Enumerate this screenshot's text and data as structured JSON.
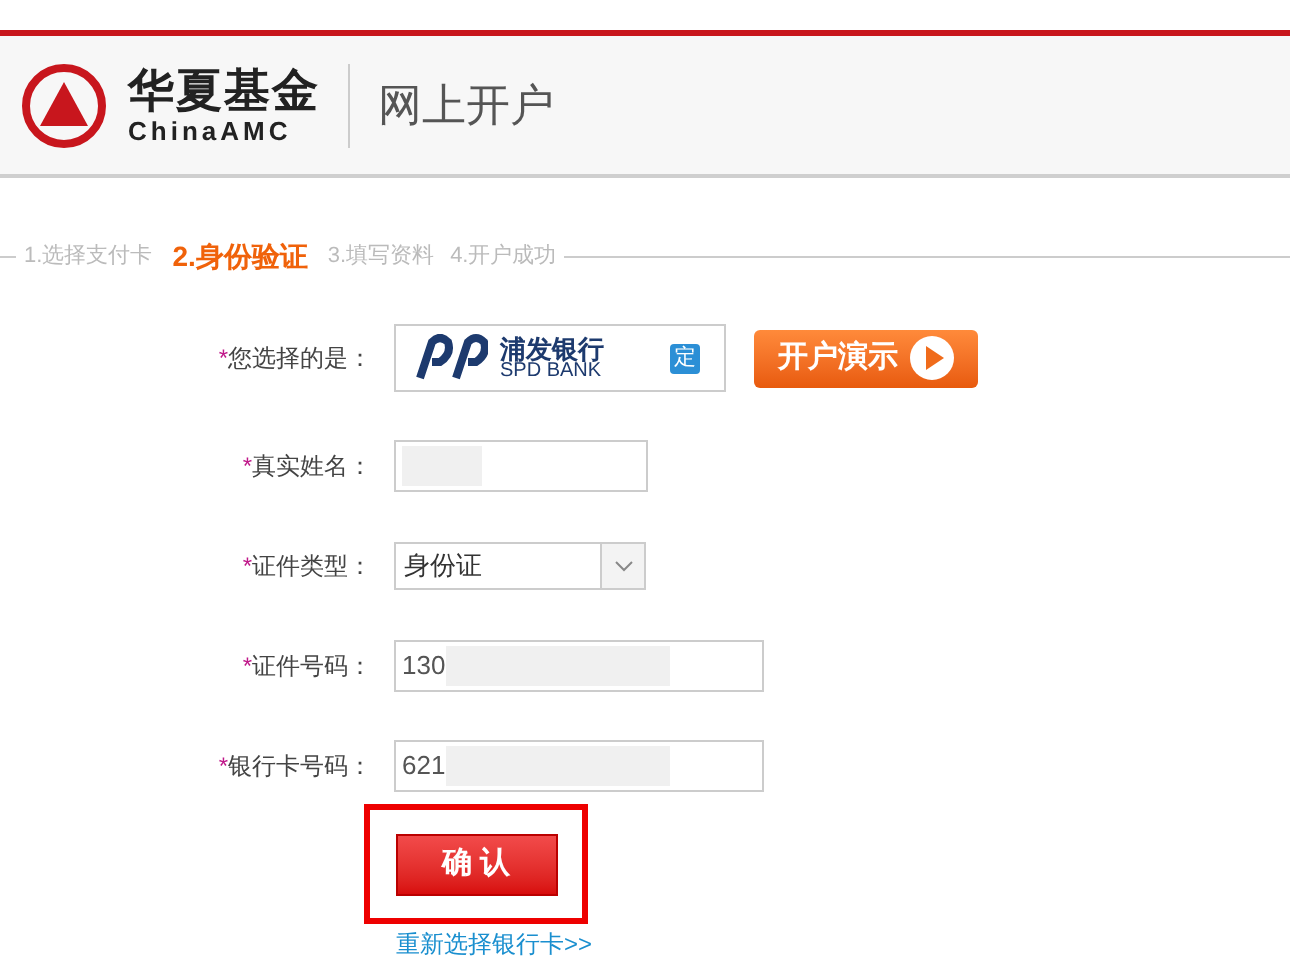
{
  "header": {
    "brand_cn": "华夏基金",
    "brand_en": "ChinaAMC",
    "title": "网上开户"
  },
  "steps": [
    {
      "label": "1.选择支付卡",
      "selected": false
    },
    {
      "label": "2.身份验证",
      "selected": true
    },
    {
      "label": "3.填写资料",
      "selected": false
    },
    {
      "label": "4.开户成功",
      "selected": false
    }
  ],
  "form": [
    {
      "kind": "bank",
      "marker": "*",
      "label": "您选择的是：",
      "bank_cn": "浦发银行",
      "bank_en": "SPD BANK",
      "badge": "定",
      "demo_button": "开户演示"
    },
    {
      "kind": "text",
      "marker": "*",
      "label": "真实姓名：",
      "redacted": true
    },
    {
      "kind": "select",
      "marker": "*",
      "label": "证件类型：",
      "value": "身份证"
    },
    {
      "kind": "text",
      "marker": "*",
      "label": "证件号码：",
      "value": "130",
      "redacted": true
    },
    {
      "kind": "text",
      "marker": "*",
      "label": "银行卡号码：",
      "value": "621",
      "redacted": true
    }
  ],
  "confirm_button": "确 认",
  "highlighted": true,
  "reselect_link": "重新选择银行卡>>"
}
